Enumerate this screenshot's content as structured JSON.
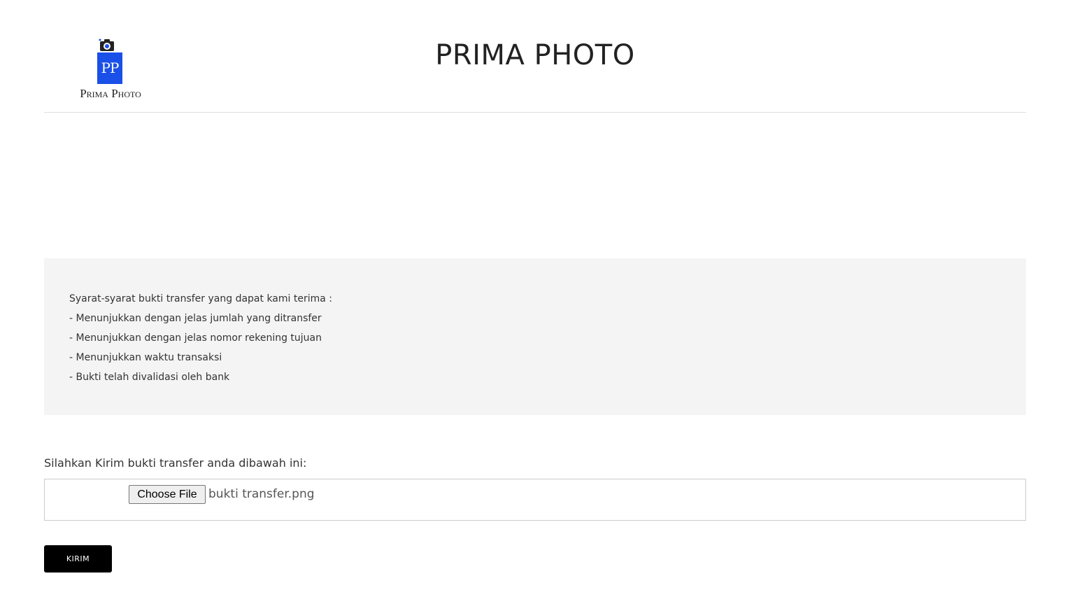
{
  "header": {
    "logo_initials": "PP",
    "logo_text": "Prima Photo",
    "title": "PRIMA PHOTO"
  },
  "requirements": {
    "heading": "Syarat-syarat bukti transfer yang dapat kami terima :",
    "items": [
      "- Menunjukkan dengan jelas jumlah yang ditransfer",
      "- Menunjukkan dengan jelas nomor rekening tujuan",
      "- Menunjukkan waktu transaksi",
      "- Bukti telah divalidasi oleh bank"
    ]
  },
  "upload": {
    "label": "Silahkan Kirim bukti transfer anda dibawah ini:",
    "choose_label": "Choose File",
    "file_name": "bukti transfer.png"
  },
  "submit": {
    "label": "KIRIM"
  },
  "colors": {
    "logo_blue": "#1a4fe8",
    "requirements_bg": "#f4f4f4",
    "submit_bg": "#000000"
  },
  "icons": {
    "logo_camera": "camera-icon"
  }
}
